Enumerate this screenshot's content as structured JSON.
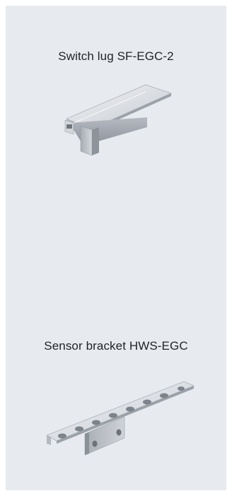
{
  "products": [
    {
      "name": "Switch lug SF-EGC-2",
      "image_icon": "switch-lug-image"
    },
    {
      "name": "Sensor bracket HWS-EGC",
      "image_icon": "sensor-bracket-image"
    }
  ],
  "colors": {
    "panel_background": "#e7eaee",
    "text": "#1f2328",
    "metal_light": "#e9ebee",
    "metal_mid": "#c3c8cf",
    "metal_dark": "#8f959c"
  }
}
